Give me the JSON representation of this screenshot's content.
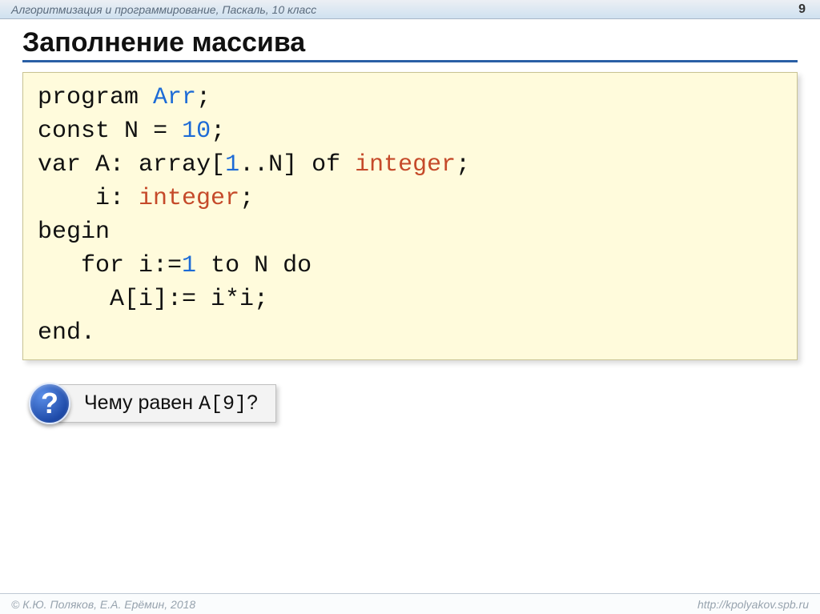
{
  "topbar": {
    "breadcrumb": "Алгоритмизация и программирование, Паскаль, 10 класс",
    "page_number": "9"
  },
  "title": "Заполнение массива",
  "code": {
    "l1": {
      "kw1": "program",
      "name": "Arr",
      "t": ";"
    },
    "l2": {
      "kw": "const",
      "id": "N",
      "eq": "=",
      "num": "10",
      "t": ";"
    },
    "l3": {
      "kw": "var",
      "id": "A",
      "t1": ": array[",
      "num": "1",
      "t2": "..N] of ",
      "type": "integer",
      "t3": ";"
    },
    "l4": {
      "pad": "    ",
      "id": "i",
      "t1": ": ",
      "type": "integer",
      "t2": ";"
    },
    "l5": {
      "kw": "begin"
    },
    "l6": {
      "pad": "   ",
      "kw1": "for",
      "s1": " i:=",
      "num": "1",
      "s2": " to N ",
      "kw2": "do"
    },
    "l7": {
      "pad": "     ",
      "expr": "A[i]:= i*i;"
    },
    "l8": {
      "kw": "end",
      "t": "."
    }
  },
  "question": {
    "glyph": "?",
    "prefix": "Чему равен ",
    "mono": "A[9]",
    "suffix": "?"
  },
  "footer": {
    "copyright": "© К.Ю. Поляков, Е.А. Ерёмин, 2018",
    "url": "http://kpolyakov.spb.ru"
  }
}
